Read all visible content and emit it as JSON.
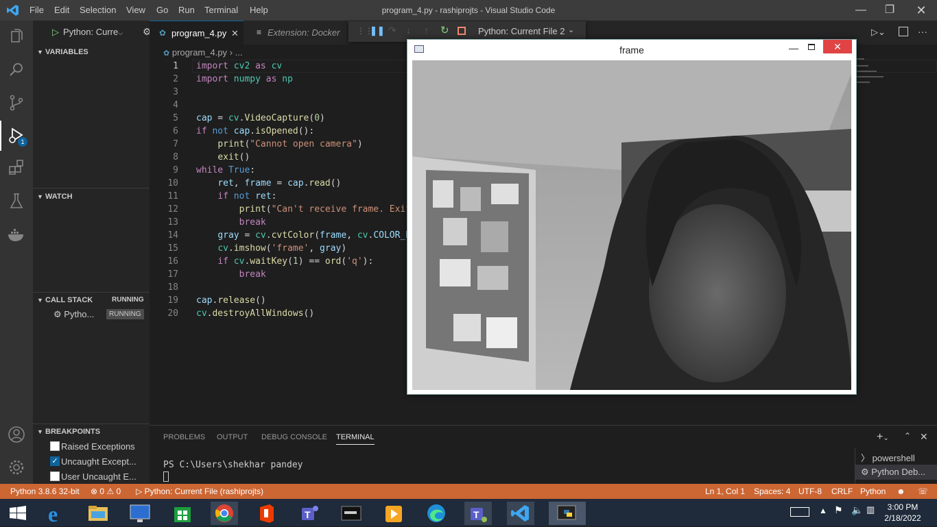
{
  "titlebar": {
    "menu": [
      "File",
      "Edit",
      "Selection",
      "View",
      "Go",
      "Run",
      "Terminal",
      "Help"
    ],
    "window_title": "program_4.py - rashiprojts - Visual Studio Code"
  },
  "activitybar": {
    "debug_badge": "1"
  },
  "debug_toolbar": {
    "config": "Python: Curre",
    "config_full": "Python: Current File 2"
  },
  "tabs": {
    "active": "program_4.py",
    "inactive": "Extension: Docker"
  },
  "breadcrumb": {
    "file": "program_4.py",
    "more": "..."
  },
  "sidebar": {
    "variables": "VARIABLES",
    "watch": "WATCH",
    "call_stack": "CALL STACK",
    "call_stack_status": "RUNNING",
    "thread_name": "Pytho...",
    "thread_status": "RUNNING",
    "breakpoints": "BREAKPOINTS",
    "bp_items": [
      {
        "label": "Raised Exceptions",
        "checked": false
      },
      {
        "label": "Uncaught Except...",
        "checked": true
      },
      {
        "label": "User Uncaught E...",
        "checked": false
      }
    ]
  },
  "editor": {
    "line_numbers": [
      "1",
      "2",
      "3",
      "4",
      "5",
      "6",
      "7",
      "8",
      "9",
      "10",
      "11",
      "12",
      "13",
      "14",
      "15",
      "16",
      "17",
      "18",
      "19",
      "20"
    ]
  },
  "panel": {
    "tabs": [
      "PROBLEMS",
      "OUTPUT",
      "DEBUG CONSOLE",
      "TERMINAL"
    ],
    "terminal_prompt": "PS C:\\Users\\shekhar pandey",
    "terminals": [
      "powershell",
      "Python Deb..."
    ]
  },
  "statusbar": {
    "python": "Python 3.8.6 32-bit",
    "problems": "⊗ 0 ⚠ 0",
    "debug": "Python: Current File (rashiprojts)",
    "position": "Ln 1, Col 1",
    "spaces": "Spaces: 4",
    "encoding": "UTF-8",
    "eol": "CRLF",
    "language": "Python"
  },
  "framewindow": {
    "title": "frame"
  },
  "taskbar": {
    "time": "3:00 PM",
    "date": "2/18/2022"
  },
  "colors": {
    "statusbar": "#cc6633",
    "accent": "#0e639c",
    "taskbar": "#1f2a3a"
  }
}
